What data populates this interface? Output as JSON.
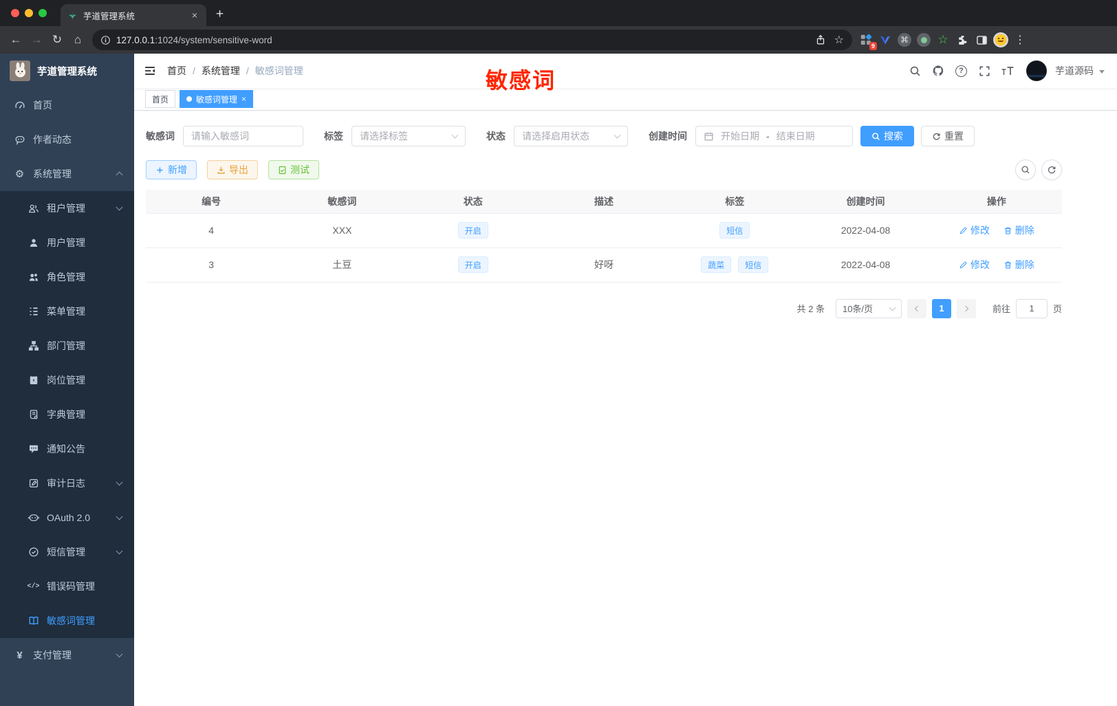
{
  "browser": {
    "tab_title": "芋道管理系统",
    "url_host": "127.0.0.1",
    "url_path": ":1024/system/sensitive-word",
    "extension_badge": "9"
  },
  "icons": {
    "back": "←",
    "forward": "→",
    "reload": "↻",
    "home": "⌂",
    "star": "☆",
    "command": "⌘",
    "dots": "⋮",
    "new_tab": "+",
    "close": "×",
    "gear": "⚙",
    "yen": "¥",
    "code": "</>",
    "help": "?"
  },
  "annotation": {
    "text": "敏感词",
    "color": "#ff2600"
  },
  "sidebar": {
    "title": "芋道管理系统",
    "items": [
      {
        "label": "首页"
      },
      {
        "label": "作者动态"
      },
      {
        "label": "系统管理"
      },
      {
        "label": "租户管理"
      },
      {
        "label": "用户管理"
      },
      {
        "label": "角色管理"
      },
      {
        "label": "菜单管理"
      },
      {
        "label": "部门管理"
      },
      {
        "label": "岗位管理"
      },
      {
        "label": "字典管理"
      },
      {
        "label": "通知公告"
      },
      {
        "label": "审计日志"
      },
      {
        "label": "OAuth 2.0"
      },
      {
        "label": "短信管理"
      },
      {
        "label": "错误码管理"
      },
      {
        "label": "敏感词管理"
      },
      {
        "label": "支付管理"
      }
    ]
  },
  "navbar": {
    "breadcrumb": {
      "home": "首页",
      "sep": "/",
      "section": "系统管理",
      "current": "敏感词管理"
    },
    "username": "芋道源码"
  },
  "tags_view": {
    "home": "首页",
    "active": "敏感词管理"
  },
  "filters": {
    "keyword": {
      "label": "敏感词",
      "placeholder": "请输入敏感词"
    },
    "tag": {
      "label": "标签",
      "placeholder": "请选择标签"
    },
    "status": {
      "label": "状态",
      "placeholder": "请选择启用状态"
    },
    "create_time": {
      "label": "创建时间",
      "start_placeholder": "开始日期",
      "separator": "-",
      "end_placeholder": "结束日期"
    },
    "search_label": "搜索",
    "reset_label": "重置"
  },
  "actions": {
    "add": "新增",
    "export": "导出",
    "test": "测试"
  },
  "table": {
    "columns": [
      "编号",
      "敏感词",
      "状态",
      "描述",
      "标签",
      "创建时间",
      "操作"
    ],
    "rows": [
      {
        "id": "4",
        "word": "XXX",
        "status": "开启",
        "description": "",
        "tags": [
          "短信"
        ],
        "create_time": "2022-04-08"
      },
      {
        "id": "3",
        "word": "土豆",
        "status": "开启",
        "description": "好呀",
        "tags": [
          "蔬菜",
          "短信"
        ],
        "create_time": "2022-04-08"
      }
    ],
    "edit": "修改",
    "delete": "删除"
  },
  "pagination": {
    "total": "共 2 条",
    "size": "10条/页",
    "page": "1",
    "goto": "前往",
    "goto_value": "1",
    "unit": "页"
  },
  "colors": {
    "accent": "#409eff",
    "annotation_red": "#ff2600",
    "success": "#67c23a",
    "warning": "#e6a23c",
    "sidebar_bg": "#304156",
    "submenu_bg": "#1f2d3d",
    "tag_bg": "#ecf5ff",
    "table_header_bg": "#f8f8f9"
  }
}
